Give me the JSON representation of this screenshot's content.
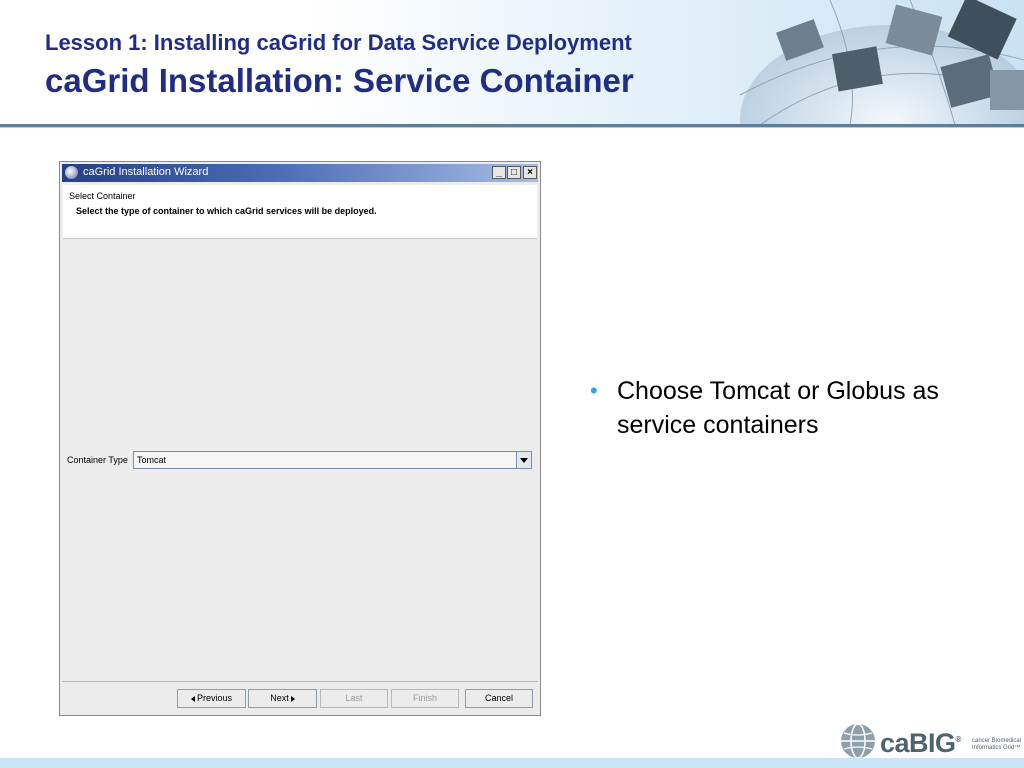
{
  "slide": {
    "lesson_title": "Lesson 1: Installing caGrid for Data Service Deployment",
    "main_title": "caGrid Installation: Service Container",
    "title_color": "#1f2d86",
    "accent_color": "#29a8e0"
  },
  "wizard": {
    "window_title": "caGrid Installation Wizard",
    "window_controls": {
      "minimize": "_",
      "maximize": "□",
      "close": "×"
    },
    "step_title": "Select Container",
    "step_description": "Select the type of container to which caGrid services will be deployed.",
    "container_type_label": "Container Type",
    "container_type_value": "Tomcat",
    "buttons": {
      "previous": "Previous",
      "next": "Next",
      "last": "Last",
      "finish": "Finish",
      "cancel": "Cancel"
    },
    "button_states": {
      "previous": "enabled",
      "next": "enabled",
      "last": "disabled",
      "finish": "disabled",
      "cancel": "enabled"
    }
  },
  "bullets": [
    "Choose Tomcat or Globus as service containers"
  ],
  "footer": {
    "logo_text": "caBIG",
    "logo_mark": "®",
    "logo_subtext": "cancer Biomedical Informatics Grid™"
  }
}
